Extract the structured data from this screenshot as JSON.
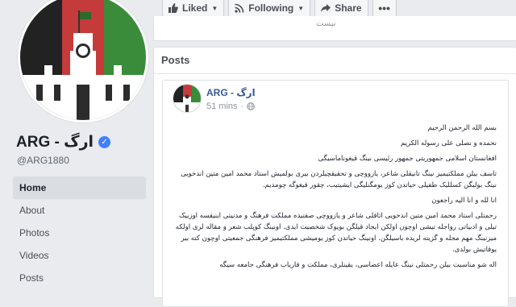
{
  "page": {
    "name": "ARG - ارگ",
    "handle": "@ARG1880"
  },
  "nav": {
    "items": [
      "Home",
      "About",
      "Photos",
      "Videos",
      "Posts"
    ]
  },
  "actions": {
    "liked_label": "Liked",
    "following_label": "Following",
    "share_label": "Share",
    "more_label": "•••"
  },
  "top_card": {
    "text": "نیست"
  },
  "posts": {
    "title": "Posts",
    "post": {
      "author": "ARG - ارگ",
      "time": "51 mins",
      "lines": [
        "بسم الله الرحمن الرحیم",
        "نحمده و نصلی علی رسوله الکریم",
        "افغانستان اسلامی جمهوریتی جمهور رئیسی نینگ قیغوناماسیگی",
        "تاسف بیلن مملکتیمیز نینگ تانیقلی شاعر، یازووچی و تحقیقچیلردن بیری بولمیش استاد محمد امین متین اندخویی نینگ بولیگن کسللیک طفیلی حیاتدن کوز یومگنلیگی ایشیتیب، چقور قیغوگه چومدیم.",
        "انا لله و انا الیه راجعون",
        "رحمتلی استاد محمد امین متین اندخویی اتاقلی شاعر و یازووچی صفتیده مملکت فرهنگ و مدنیتی اینیقسه اوزبیک تیلی و ادبیاتی رواجله تیشی اوچون اولکن ایجاد قیلگن بویوک شخصیت ایدی. اونینگ کوپلب شعر و مقاله لری اولکه میزنینگ مهم مجله و گزیته لریده باسیلگن. اونینگ حیاتدن کوز یومیشی مملکتیمیز فرهنگی جمعیتی اوچون کته بیر یوقاتیش بولدی.",
        "اله شو مناسبت بیلن رحمتلی نینگ عایله اعضاسی، یقینلری، مملکت و فاریاب فرهنگی جامعه سیگه"
      ]
    }
  },
  "colors": {
    "link_blue": "#385898",
    "verified_blue": "#4080ff",
    "page_bg": "#e9ebee"
  }
}
